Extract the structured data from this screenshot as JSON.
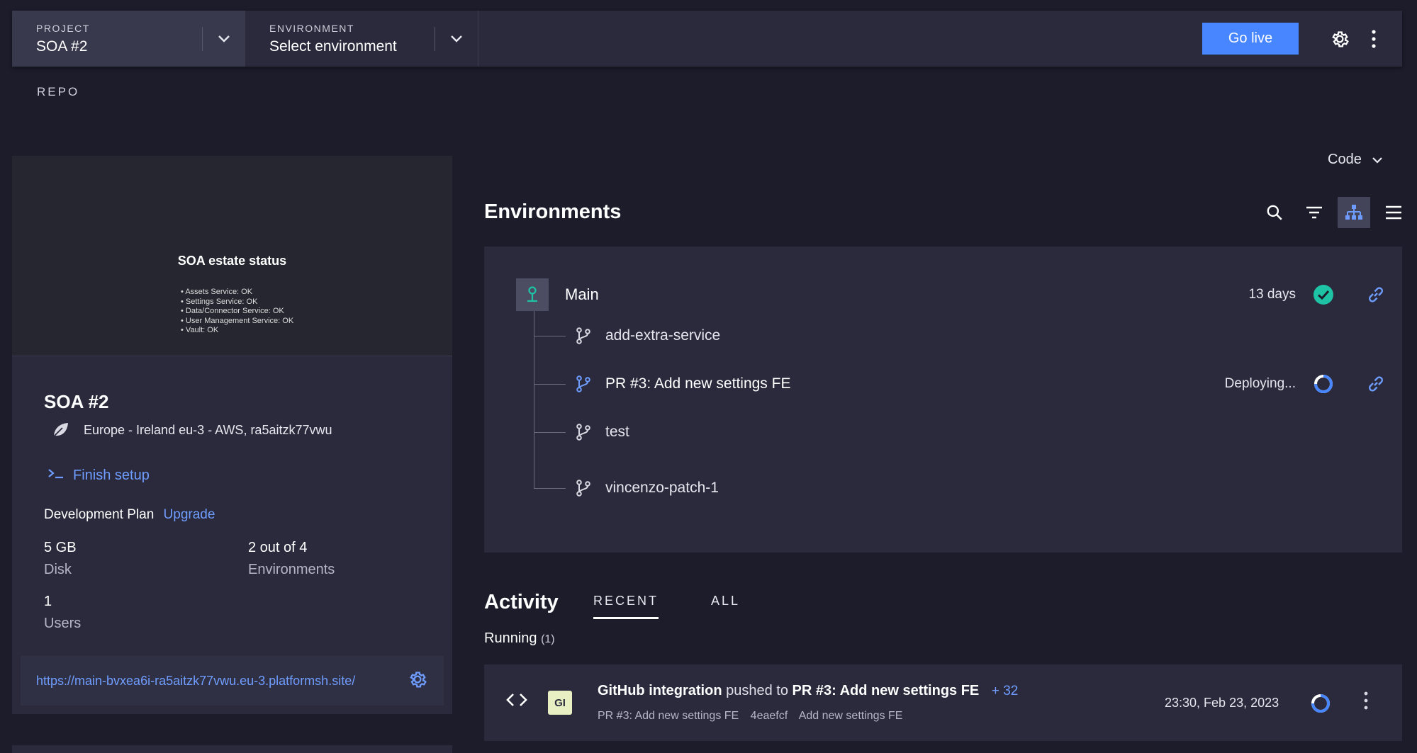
{
  "topbar": {
    "project_label": "PROJECT",
    "project_value": "SOA #2",
    "environment_label": "ENVIRONMENT",
    "environment_value": "Select environment",
    "go_live_label": "Go live",
    "icons": [
      "chevron-down-icon",
      "gear-icon",
      "more-vertical-icon"
    ]
  },
  "repo_label": "REPO",
  "project_card": {
    "preview": {
      "title": "SOA estate status",
      "items": [
        "Assets Service: OK",
        "Settings Service: OK",
        "Data/Connector Service: OK",
        "User Management Service: OK",
        "Vault: OK"
      ]
    },
    "title": "SOA #2",
    "region": "Europe - Ireland eu-3 - AWS, ra5aitzk77vwu",
    "finish_setup": "Finish setup",
    "plan_label": "Development Plan",
    "upgrade_label": "Upgrade",
    "stats": [
      {
        "value": "5 GB",
        "label": "Disk"
      },
      {
        "value": "2 out of 4",
        "label": "Environments"
      },
      {
        "value": "1",
        "label": "Users"
      }
    ],
    "url": "https://main-bvxea6i-ra5aitzk77vwu.eu-3.platformsh.site/"
  },
  "code_dropdown_label": "Code",
  "environments": {
    "title": "Environments",
    "tools": [
      "search-icon",
      "filter-icon",
      "tree-view-icon",
      "list-view-icon"
    ],
    "main": {
      "label": "Main",
      "meta": "13 days",
      "status": "success"
    },
    "branches": [
      {
        "label": "add-extra-service",
        "meta": "",
        "status": "none",
        "active": false
      },
      {
        "label": "PR #3: Add new settings FE",
        "meta": "Deploying...",
        "status": "deploying",
        "active": true
      },
      {
        "label": "test",
        "meta": "",
        "status": "none",
        "active": false
      },
      {
        "label": "vincenzo-patch-1",
        "meta": "",
        "status": "none",
        "active": false
      }
    ],
    "colors": {
      "success": "#1ec3a6",
      "accent": "#4786ff"
    }
  },
  "activity": {
    "title": "Activity",
    "tabs": [
      {
        "label": "RECENT",
        "active": true
      },
      {
        "label": "ALL",
        "active": false
      }
    ],
    "running_label": "Running",
    "running_count": "(1)",
    "item": {
      "badge": "GI",
      "actor": "GitHub integration",
      "verb": "pushed to",
      "target": "PR #3: Add new settings FE",
      "extra": "+ 32",
      "sub_branch": "PR #3: Add new settings FE",
      "sub_commit": "4eaefcf",
      "sub_message": "Add new settings FE",
      "time": "23:30, Feb 23, 2023"
    }
  }
}
